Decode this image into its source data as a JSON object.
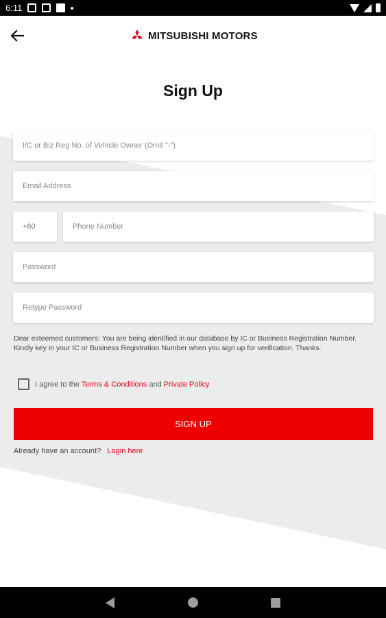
{
  "status_bar": {
    "time": "6:11",
    "icons": [
      "notification-icon",
      "notification-icon",
      "app-icon",
      "dot-icon",
      "wifi-icon",
      "signal-icon",
      "battery-icon"
    ]
  },
  "header": {
    "back_icon": "arrow-left-icon",
    "brand": "MITSUBISHI MOTORS",
    "brand_color": "#e60012"
  },
  "page": {
    "title": "Sign Up"
  },
  "form": {
    "ic_placeholder": "I/C or Biz Reg No. of Vehicle Owner (Omit \"-\")",
    "email_placeholder": "Email Address",
    "country_code": "+60",
    "phone_placeholder": "Phone Number",
    "password_placeholder": "Password",
    "retype_placeholder": "Retype Password"
  },
  "notice": {
    "text": "Dear esteemed customers: You are being identified in our database by IC or Business Registration Number. Kindly key in your IC or Business Registration Number when you sign up for verification. Thanks."
  },
  "agree": {
    "prefix": "I agree to the",
    "terms": "Terms & Conditions",
    "and": "and",
    "privacy": "Private Policy"
  },
  "signup_button": {
    "label": "SIGN UP",
    "color": "#ee0000"
  },
  "login": {
    "prompt": "Already have an account?",
    "link": "Login here"
  },
  "nav_bar": {
    "icons": [
      "nav-back-icon",
      "nav-home-icon",
      "nav-recents-icon"
    ]
  }
}
